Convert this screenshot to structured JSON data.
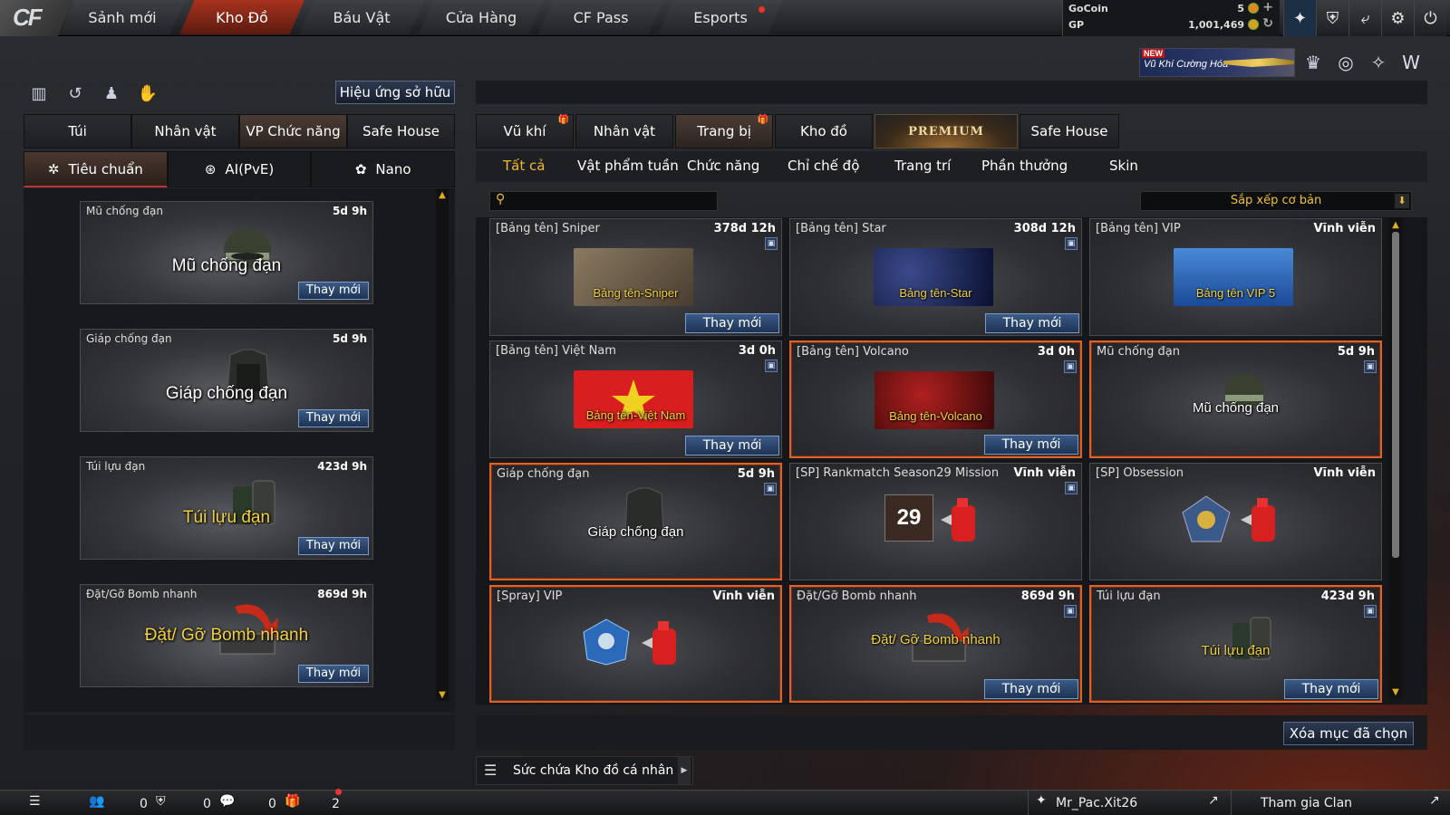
{
  "app": {
    "logo": "CF"
  },
  "nav": {
    "tabs": [
      "Sảnh mới",
      "Kho Đồ",
      "Báu Vật",
      "Cửa Hàng",
      "CF Pass",
      "Esports"
    ],
    "active": "Kho Đồ"
  },
  "currency": {
    "gocoin_label": "GoCoin",
    "gocoin_value": "5",
    "gp_label": "GP",
    "gp_value": "1,001,469"
  },
  "top_icons": [
    "clan-icon",
    "shield-icon",
    "exit-icon",
    "gear-icon",
    "power-icon"
  ],
  "promo": {
    "badge": "NEW",
    "text": "Vũ Khí Cường Hóa"
  },
  "side_icons": [
    "vip-icon",
    "globe-icon",
    "wrench-icon",
    "w-icon"
  ],
  "left": {
    "effect_button": "Hiệu ứng sở hữu",
    "tabs": [
      "Túi",
      "Nhân vật",
      "VP Chức năng",
      "Safe House"
    ],
    "active_tab": "VP Chức năng",
    "subtabs": [
      {
        "label": "Tiêu chuẩn",
        "icon": "star-icon"
      },
      {
        "label": "AI(PvE)",
        "icon": "ai-icon"
      },
      {
        "label": "Nano",
        "icon": "nano-icon"
      }
    ],
    "items": [
      {
        "name": "Mũ chống đạn",
        "time": "5d 9h",
        "big": "Mũ chống đạn",
        "button": "Thay mới"
      },
      {
        "name": "Giáp chống đạn",
        "time": "5d 9h",
        "big": "Giáp chống đạn",
        "button": "Thay mới"
      },
      {
        "name": "Túi lựu đạn",
        "time": "423d 9h",
        "big": "Túi lựu đạn",
        "button": "Thay mới"
      },
      {
        "name": "Đặt/Gỡ Bomb nhanh",
        "time": "869d 9h",
        "big": "Đặt/ Gỡ Bomb nhanh",
        "button": "Thay mới"
      }
    ]
  },
  "right": {
    "tabs": [
      {
        "label": "Vũ khí",
        "gift": true
      },
      {
        "label": "Nhân vật",
        "gift": false
      },
      {
        "label": "Trang bị",
        "gift": true
      },
      {
        "label": "Kho đồ",
        "gift": false
      },
      {
        "label": "PREMIUM",
        "gift": false
      },
      {
        "label": "Safe House",
        "gift": false
      }
    ],
    "active_tab": "Trang bị",
    "categories": [
      "Tất cả",
      "Vật phẩm tuần",
      "Chức năng",
      "Chỉ chế độ",
      "Trang trí",
      "Phần thưởng",
      "Skin"
    ],
    "active_category": "Tất cả",
    "search_placeholder": "",
    "sort_label": "Sắp xếp cơ bản",
    "items": [
      {
        "name": "[Bảng tên] Sniper",
        "time": "378d 12h",
        "label": "Bảng tên-Sniper",
        "button": "Thay mới",
        "selected": false,
        "thumb": "sniper",
        "color": "#6a5a48"
      },
      {
        "name": "[Bảng tên] Star",
        "time": "308d 12h",
        "label": "Bảng tên-Star",
        "button": "Thay mới",
        "selected": false,
        "thumb": "star",
        "color": "#0e1a4a"
      },
      {
        "name": "[Bảng tên] VIP",
        "time": "Vĩnh viễn",
        "label": "Bảng tên VIP 5",
        "button": "",
        "selected": false,
        "thumb": "vip",
        "color": "#2a6ab8"
      },
      {
        "name": "[Bảng tên] Việt Nam",
        "time": "3d 0h",
        "label": "Bảng tên-Việt Nam",
        "button": "Thay mới",
        "selected": false,
        "thumb": "vn",
        "color": "#d81e1e"
      },
      {
        "name": "[Bảng tên] Volcano",
        "time": "3d 0h",
        "label": "Bảng tên-Volcano",
        "button": "Thay mới",
        "selected": true,
        "thumb": "volcano",
        "color": "#6a0a0a"
      },
      {
        "name": "Mũ chống đạn",
        "time": "5d 9h",
        "label": "Mũ chống đạn",
        "button": "",
        "selected": true,
        "thumb": "helmet",
        "color": ""
      },
      {
        "name": "Giáp chống đạn",
        "time": "5d 9h",
        "label": "Giáp chống đạn",
        "button": "",
        "selected": true,
        "thumb": "armor",
        "color": ""
      },
      {
        "name": "[SP] Rankmatch Season29 Mission",
        "time": "Vĩnh viễn",
        "label": "29",
        "button": "",
        "selected": false,
        "thumb": "spray",
        "color": ""
      },
      {
        "name": "[SP] Obsession",
        "time": "Vĩnh viễn",
        "label": "",
        "button": "",
        "selected": false,
        "thumb": "spray",
        "color": ""
      },
      {
        "name": "[Spray] VIP",
        "time": "Vĩnh viễn",
        "label": "",
        "button": "",
        "selected": true,
        "thumb": "spray",
        "color": ""
      },
      {
        "name": "Đặt/Gỡ Bomb nhanh",
        "time": "869d 9h",
        "label": "Đặt/ Gỡ Bomb nhanh",
        "button": "Thay mới",
        "selected": true,
        "thumb": "bomb",
        "color": ""
      },
      {
        "name": "Túi lựu đạn",
        "time": "423d 9h",
        "label": "Túi lựu đạn",
        "button": "Thay mới",
        "selected": true,
        "thumb": "grenade",
        "color": ""
      }
    ],
    "delete_button": "Xóa mục đã chọn",
    "capacity_label": "Sức chứa Kho đồ cá nhân"
  },
  "bottom": {
    "friends": "0",
    "clan": "0",
    "chat": "0",
    "gifts": "2",
    "username": "Mr_Pac.Xit26",
    "clan_join": "Tham gia Clan"
  }
}
